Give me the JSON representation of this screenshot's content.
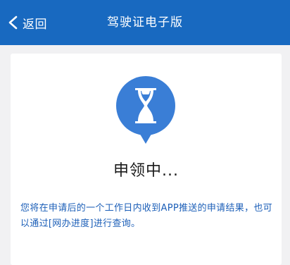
{
  "navbar": {
    "back_label": "返回",
    "title": "驾驶证电子版"
  },
  "status": {
    "icon": "hourglass-icon",
    "text": "申领中..."
  },
  "description": "您将在申请后的一个工作日内收到APP推送的申请结果，也可以通过[网办进度]进行查询。",
  "colors": {
    "brand": "#1869c0",
    "icon_bg": "#3a7ed6",
    "description_text": "#1c5fb8",
    "page_bg": "#f1f1f3"
  }
}
